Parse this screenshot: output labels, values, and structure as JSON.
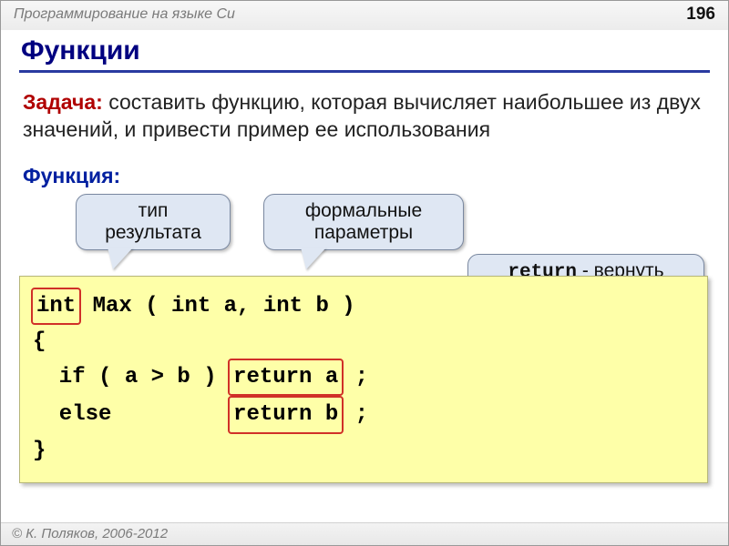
{
  "header": {
    "course": "Программирование на языке Си",
    "page": "196"
  },
  "title": "Функции",
  "task": {
    "label": "Задача:",
    "text": " составить функцию, которая вычисляет наибольшее из двух значений, и привести пример ее использования"
  },
  "subhead": "Функция:",
  "bubbles": {
    "result_type": "тип результата",
    "formal_params": "формальные параметры",
    "return_kw": "return",
    "return_text": " - вернуть результат функции"
  },
  "code": {
    "int": "int",
    "sig_rest": " Max ( int a, int b )",
    "brace_open": "{",
    "if_part": "  if ( a > b ) ",
    "ret_a": "return a",
    "semi": " ;",
    "else_part": "  else         ",
    "ret_b": "return b",
    "brace_close": "}"
  },
  "footer": "© К. Поляков, 2006-2012"
}
